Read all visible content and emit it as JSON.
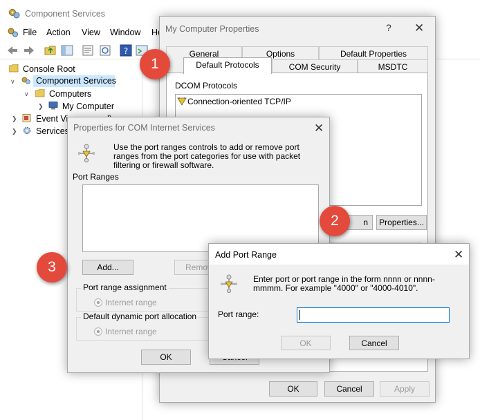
{
  "main_window": {
    "title": "Component Services",
    "menu": [
      "File",
      "Action",
      "View",
      "Window",
      "He"
    ],
    "tree": {
      "root": "Console Root",
      "component_services": "Component Services",
      "computers": "Computers",
      "my_computer": "My Computer",
      "event_viewer": "Event Vie",
      "event_viewer_tail": "l)",
      "services": "Services"
    }
  },
  "props_dialog": {
    "title": "My Computer Properties",
    "help": "?",
    "tabs_row1": [
      "General",
      "Options",
      "Default Properties"
    ],
    "tabs_row2": [
      "Default Protocols",
      "COM Security",
      "MSDTC"
    ],
    "dcom_label": "DCOM Protocols",
    "protocols": [
      "Connection-oriented TCP/IP"
    ],
    "partial_button": "n",
    "properties_button": "Properties...",
    "ok": "OK",
    "cancel": "Cancel",
    "apply": "Apply"
  },
  "com_dialog": {
    "title": "Properties for COM Internet Services",
    "description": "Use the port ranges controls to add or remove port ranges from the port categories for use with packet filtering or firewall software.",
    "port_ranges_label": "Port Ranges",
    "add_button": "Add...",
    "remove_button": "Remove",
    "assignment_label": "Port range assignment",
    "assignment_option": "Internet range",
    "dynamic_label": "Default dynamic port allocation",
    "dynamic_option": "Internet range",
    "ok": "OK",
    "cancel_partial": "Cancel"
  },
  "add_dialog": {
    "title": "Add Port Range",
    "description": "Enter port or port range in the form  nnnn or nnnn-mmmm. For example \"4000\" or \"4000-4010\".",
    "port_range_label": "Port range:",
    "port_range_value": "",
    "ok": "OK",
    "cancel": "Cancel"
  },
  "badges": [
    "1",
    "2",
    "3"
  ],
  "colors": {
    "desktop": "#1b8fd6",
    "badge": "#e34a3c",
    "focus": "#0078d7"
  }
}
